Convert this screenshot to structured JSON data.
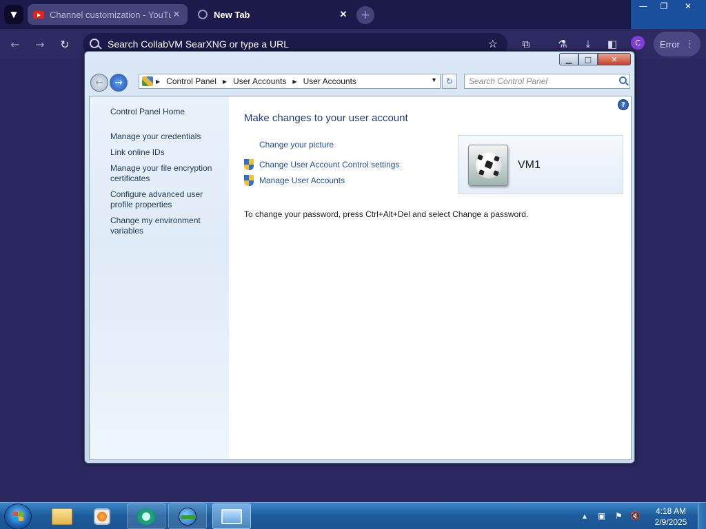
{
  "browser": {
    "tabs": [
      {
        "label": "Channel customization - YouTube",
        "active": false
      },
      {
        "label": "New Tab",
        "active": true
      }
    ],
    "omnibox_placeholder": "Search CollabVM SearXNG or type a URL",
    "profile_initial": "C",
    "error_label": "Error"
  },
  "explorer": {
    "breadcrumb": [
      "Control Panel",
      "User Accounts",
      "User Accounts"
    ],
    "search_placeholder": "Search Control Panel",
    "left_pane": {
      "home_link": "Control Panel Home",
      "links": [
        "Manage your credentials",
        "Link online IDs",
        "Manage your file encryption certificates",
        "Configure advanced user profile properties",
        "Change my environment variables"
      ]
    },
    "main": {
      "title": "Make changes to your user account",
      "tasks": [
        {
          "label": "Change your picture",
          "shield": false
        },
        {
          "label": "Change User Account Control settings",
          "shield": true
        },
        {
          "label": "Manage User Accounts",
          "shield": true
        }
      ],
      "password_note": "To change your password, press Ctrl+Alt+Del and select Change a password.",
      "user_name": "VM1"
    }
  },
  "taskbar": {
    "time": "4:18 AM",
    "date": "2/9/2025"
  }
}
